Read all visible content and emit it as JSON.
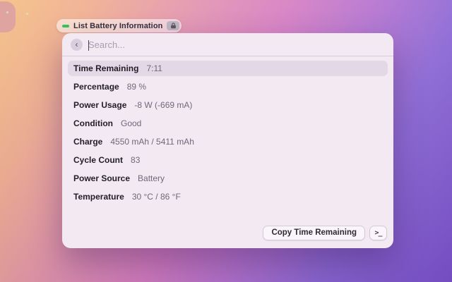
{
  "header_pill": {
    "label": "List Battery Information",
    "battery_icon": "battery-level-icon",
    "lock_icon": "lock-icon",
    "accent_green": "#35c759"
  },
  "search": {
    "placeholder": "Search...",
    "back_icon": "‹"
  },
  "list": {
    "selected_index": 0,
    "items": [
      {
        "label": "Time Remaining",
        "value": "7:11"
      },
      {
        "label": "Percentage",
        "value": "89 %"
      },
      {
        "label": "Power Usage",
        "value": "-8 W (-669 mA)"
      },
      {
        "label": "Condition",
        "value": "Good"
      },
      {
        "label": "Charge",
        "value": "4550 mAh / 5411 mAh"
      },
      {
        "label": "Cycle Count",
        "value": "83"
      },
      {
        "label": "Power Source",
        "value": "Battery"
      },
      {
        "label": "Temperature",
        "value": "30 °C / 86 °F"
      }
    ]
  },
  "footer": {
    "primary_action": "Copy Time Remaining",
    "terminal_glyph": ">_"
  },
  "colors": {
    "panel_bg": "#f2e9f3",
    "selection_bg": "#e3d8e6",
    "gradient_stops": [
      "#f4c083",
      "#e294b0",
      "#d77fc2",
      "#7a51cb"
    ]
  }
}
